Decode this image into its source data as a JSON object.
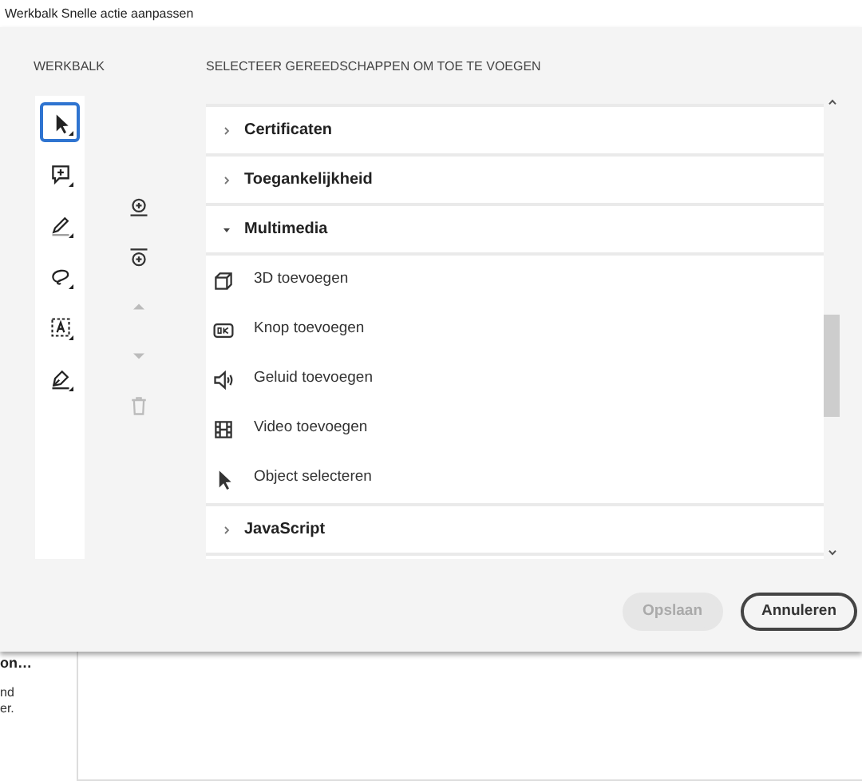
{
  "window": {
    "title": "Werkbalk Snelle actie aanpassen"
  },
  "toolbar_heading": "WERKBALK",
  "tools": [
    {
      "kind": "pointer",
      "selected": true
    },
    {
      "kind": "comment",
      "selected": false
    },
    {
      "kind": "pen",
      "selected": false
    },
    {
      "kind": "lasso",
      "selected": false
    },
    {
      "kind": "textbox",
      "selected": false
    },
    {
      "kind": "sign",
      "selected": false
    }
  ],
  "actions": [
    {
      "kind": "add-before",
      "disabled": false
    },
    {
      "kind": "add-after",
      "disabled": false
    },
    {
      "kind": "up",
      "disabled": true
    },
    {
      "kind": "down",
      "disabled": true
    },
    {
      "kind": "delete",
      "disabled": true
    }
  ],
  "list_heading": "SELECTEER GEREEDSCHAPPEN OM TOE TE VOEGEN",
  "categories": [
    {
      "label": "Certificaten",
      "expanded": false
    },
    {
      "label": "Toegankelijkheid",
      "expanded": false
    },
    {
      "label": "Multimedia",
      "expanded": true,
      "children": [
        {
          "kind": "cube",
          "label": "3D toevoegen"
        },
        {
          "kind": "ok",
          "label": "Knop toevoegen"
        },
        {
          "kind": "speaker",
          "label": "Geluid toevoegen"
        },
        {
          "kind": "film",
          "label": "Video toevoegen"
        },
        {
          "kind": "pointer",
          "label": "Object selecteren"
        }
      ]
    },
    {
      "label": "JavaScript",
      "expanded": false
    }
  ],
  "buttons": [
    {
      "label": "Opslaan",
      "kind": "primary",
      "disabled": true
    },
    {
      "label": "Annuleren",
      "kind": "secondary",
      "disabled": false
    }
  ],
  "background": {
    "heading": "on…",
    "lines": [
      "nd",
      "er."
    ]
  }
}
